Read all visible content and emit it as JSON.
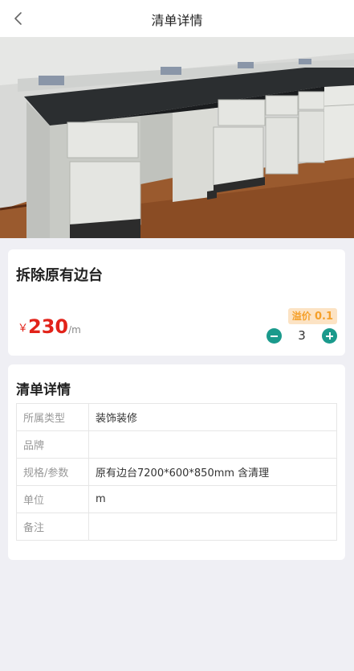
{
  "header": {
    "title": "清单详情",
    "back_icon": "chevron-left-icon"
  },
  "product": {
    "name": "拆除原有边台",
    "currency": "￥",
    "price": "230",
    "unit": "/m",
    "premium_label": "溢价",
    "premium_value": "0.1",
    "quantity": "3",
    "colors": {
      "price": "#e2231a",
      "accent": "#1a9a8c",
      "premium": "#f5a02a"
    }
  },
  "detail": {
    "title": "清单详情",
    "rows": [
      {
        "key": "所属类型",
        "value": "装饰装修"
      },
      {
        "key": "品牌",
        "value": ""
      },
      {
        "key": "规格/参数",
        "value": "原有边台7200*600*850mm 含清理"
      },
      {
        "key": "单位",
        "value": "m"
      },
      {
        "key": "备注",
        "value": ""
      }
    ]
  }
}
